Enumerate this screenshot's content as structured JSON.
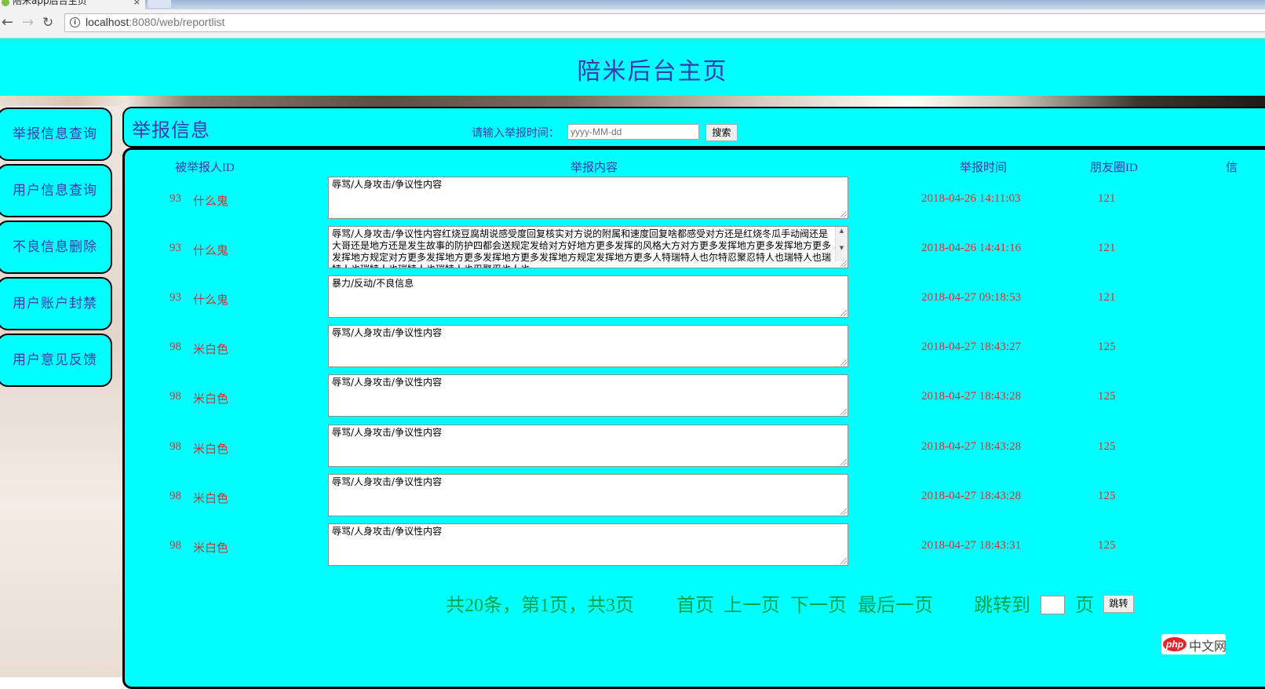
{
  "browser": {
    "tab_title": "陪米app后台主页",
    "tab_close": "×",
    "url_host": "localhost",
    "url_rest": ":8080/web/reportlist",
    "back_icon": "arrow-left-icon",
    "forward_icon": "arrow-right-icon",
    "reload_icon": "reload-icon",
    "info_icon": "info-icon"
  },
  "header": {
    "title": "陪米后台主页"
  },
  "sidebar": {
    "items": [
      {
        "label": "举报信息查询"
      },
      {
        "label": "用户信息查询"
      },
      {
        "label": "不良信息删除"
      },
      {
        "label": "用户账户封禁"
      },
      {
        "label": "用户意见反馈"
      }
    ]
  },
  "panel": {
    "title": "举报信息",
    "search_label": "请输入举报时间：",
    "search_placeholder": "yyyy-MM-dd",
    "search_button": "搜索"
  },
  "table": {
    "headers": [
      "被举报人ID",
      "举报内容",
      "举报时间",
      "朋友圈ID",
      "信"
    ],
    "rows": [
      {
        "id": "93",
        "name": "什么鬼",
        "content": "辱骂/人身攻击/争议性内容",
        "time": "2018-04-26 14:11:03",
        "moment": "121"
      },
      {
        "id": "93",
        "name": "什么鬼",
        "content": "辱骂/人身攻击/争议性内容红烧豆腐胡说感受度回复核实对方说的附属和速度回复啥都感受对方还是红烧冬瓜手动阀还是大哥还是地方还是发生故事的防护四都会送规定发给对方好地方更多发挥的风格大方对方更多发挥地方更多发挥地方更多发挥地方规定对方更多发挥地方更多发挥地方更多发挥地方规定发挥地方更多人特瑞特人也尔特忍聚忍特人也瑞特人也瑞特人也瑞特人也瑞特人也瑞特人也忍聚忍也人也",
        "time": "2018-04-26 14:41:16",
        "moment": "121"
      },
      {
        "id": "93",
        "name": "什么鬼",
        "content": "暴力/反动/不良信息",
        "time": "2018-04-27 09:18:53",
        "moment": "121"
      },
      {
        "id": "98",
        "name": "米白色",
        "content": "辱骂/人身攻击/争议性内容",
        "time": "2018-04-27 18:43:27",
        "moment": "125"
      },
      {
        "id": "98",
        "name": "米白色",
        "content": "辱骂/人身攻击/争议性内容",
        "time": "2018-04-27 18:43:28",
        "moment": "125"
      },
      {
        "id": "98",
        "name": "米白色",
        "content": "辱骂/人身攻击/争议性内容",
        "time": "2018-04-27 18:43:28",
        "moment": "125"
      },
      {
        "id": "98",
        "name": "米白色",
        "content": "辱骂/人身攻击/争议性内容",
        "time": "2018-04-27 18:43:28",
        "moment": "125"
      },
      {
        "id": "98",
        "name": "米白色",
        "content": "辱骂/人身攻击/争议性内容",
        "time": "2018-04-27 18:43:31",
        "moment": "125"
      }
    ]
  },
  "pager": {
    "summary": "共20条，第1页，共3页",
    "first": "首页",
    "prev": "上一页",
    "next": "下一页",
    "last": "最后一页",
    "jump_label": "跳转到",
    "page_unit": "页",
    "jump_button": "跳转"
  },
  "watermark": {
    "logo": "php",
    "text": "中文网"
  },
  "colors": {
    "accent": "#00ffff",
    "text_blue": "#3b38b0",
    "data_red": "#e8262a",
    "pager_green": "#00a14b"
  }
}
